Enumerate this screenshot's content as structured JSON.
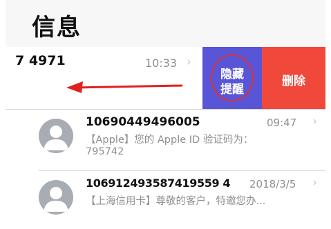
{
  "header": {
    "title": "信息"
  },
  "swiped_row": {
    "sender": "7 4971",
    "time": "10:33",
    "hide_alerts_line1": "隐藏",
    "hide_alerts_line2": "提醒",
    "delete_label": "删除"
  },
  "messages": [
    {
      "sender": "10690449496005",
      "time": "09:47",
      "preview_line1": "【Apple】您的 Apple ID 验证码为：",
      "preview_line2": "795742"
    },
    {
      "sender": "106912493587419559 4",
      "time": "2018/3/5",
      "preview_line1": "【上海信用卡】尊敬的客户，特邀您办...",
      "preview_line2": ""
    }
  ],
  "colors": {
    "hide_action": "#5856d6",
    "delete_action": "#f0483b",
    "annotation": "#e02020"
  },
  "icons": [
    "chevron-right-icon",
    "contact-avatar-icon",
    "swipe-left-arrow-icon"
  ]
}
